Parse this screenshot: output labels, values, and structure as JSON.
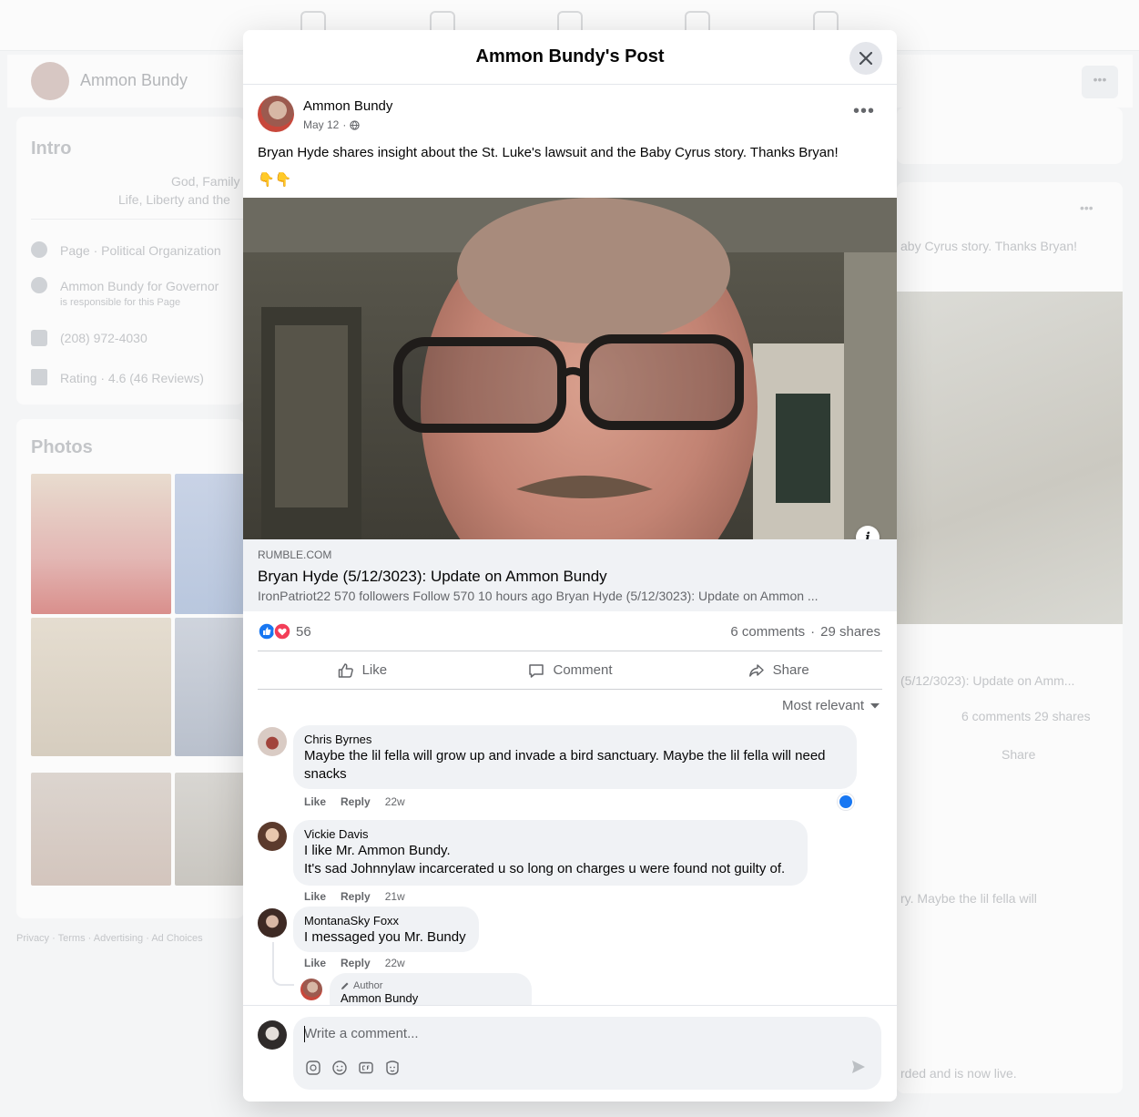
{
  "background": {
    "page_name": "Ammon Bundy",
    "intro_heading": "Intro",
    "intro_lines": [
      "God, Family",
      "Life, Liberty and the"
    ],
    "about": [
      {
        "icon": "info-icon",
        "text": "Page · Political Organization"
      },
      {
        "icon": "person-icon",
        "text": "Ammon Bundy for Governor",
        "sub": "is responsible for this Page"
      },
      {
        "icon": "phone-icon",
        "text": "(208) 972-4030"
      },
      {
        "icon": "star-icon",
        "text": "Rating · 4.6 (46 Reviews)"
      }
    ],
    "photos_heading": "Photos",
    "footer_links": "Privacy · Terms · Advertising · Ad Choices",
    "right_snippets": {
      "post_text_fragment": "aby Cyrus story. Thanks Bryan!",
      "link_fragment": "(5/12/3023): Update on Amm...",
      "stats_fragment": "6 comments  29 shares",
      "share_label": "Share",
      "comment_fragment": "ry. Maybe the lil fella will",
      "bottom_fragment": "rded and is now live."
    }
  },
  "modal": {
    "title": "Ammon Bundy's Post",
    "close_icon": "close-icon",
    "post": {
      "author": "Ammon Bundy",
      "date": "May 12",
      "separator": "·",
      "audience_icon": "globe-icon",
      "text": "Bryan Hyde shares insight about the St. Luke's lawsuit and the Baby Cyrus story. Thanks Bryan!",
      "emoji": "👇👇",
      "info_label": "i"
    },
    "link_preview": {
      "domain": "RUMBLE.COM",
      "title": "Bryan Hyde (5/12/3023): Update on Ammon Bundy",
      "description": "IronPatriot22 570 followers Follow 570 10 hours ago Bryan Hyde (5/12/3023): Update on Ammon ..."
    },
    "stats": {
      "reaction_count": "56",
      "comments": "6 comments",
      "shares": "29 shares",
      "sep": "·"
    },
    "actions": {
      "like": "Like",
      "comment": "Comment",
      "share": "Share"
    },
    "sort_label": "Most relevant",
    "comments": [
      {
        "name": "Chris Byrnes",
        "text": "Maybe the lil fella will grow up and invade a bird sanctuary. Maybe the lil fella will need snacks",
        "like": "Like",
        "reply": "Reply",
        "time": "22w"
      },
      {
        "name": "Vickie Davis",
        "text1": "I like Mr. Ammon Bundy.",
        "text2": "It's sad Johnnylaw incarcerated u so long on charges u were found not guilty of.",
        "like": "Like",
        "reply": "Reply",
        "time": "21w"
      },
      {
        "name": "MontanaSky Foxx",
        "text": "I messaged you Mr. Bundy",
        "like": "Like",
        "reply": "Reply",
        "time": "22w"
      }
    ],
    "reply": {
      "badge": "Author",
      "name": "Ammon Bundy"
    },
    "composer": {
      "placeholder": "Write a comment...",
      "tools": [
        "sticker-icon",
        "emoji-icon",
        "gif-icon",
        "avatar-sticker-icon"
      ],
      "send_icon": "send-icon"
    }
  }
}
